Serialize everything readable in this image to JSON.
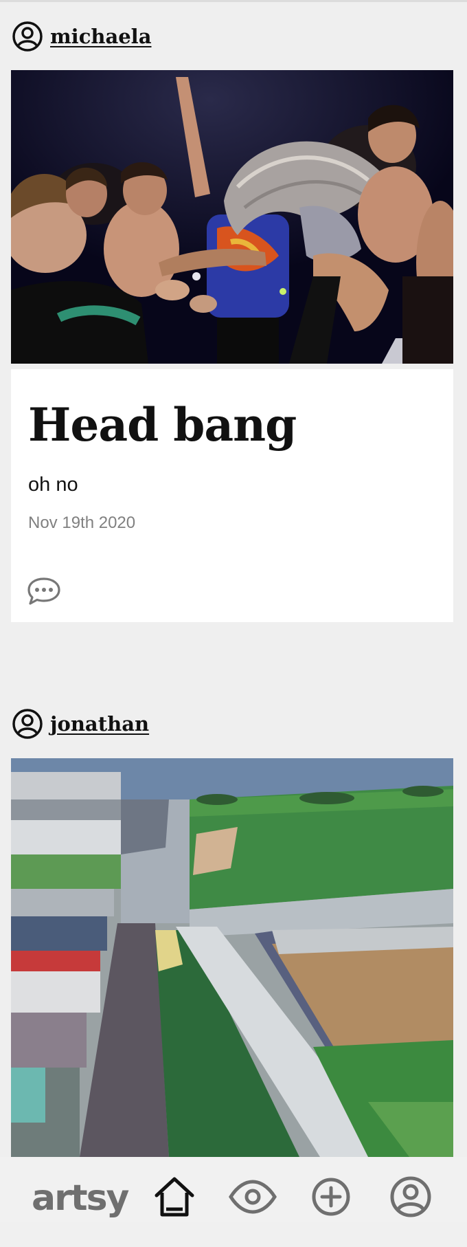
{
  "posts": [
    {
      "username": "michaela",
      "photo_alt": "photo-crowd",
      "title": "Head bang",
      "caption": "oh no",
      "date": "Nov 19th 2020",
      "comment_icon": "speech-bubble-icon"
    },
    {
      "username": "jonathan",
      "photo_alt": "photo-landscape-painting"
    }
  ],
  "tabbar": {
    "logo": "artsy",
    "tabs": [
      {
        "name": "home",
        "icon": "home-icon",
        "active": true
      },
      {
        "name": "discover",
        "icon": "eye-icon",
        "active": false
      },
      {
        "name": "create",
        "icon": "plus-circle-icon",
        "active": false
      },
      {
        "name": "profile",
        "icon": "user-circle-icon",
        "active": false
      }
    ]
  },
  "colors": {
    "background": "#efefef",
    "card": "#ffffff",
    "text": "#111111",
    "muted": "#808080",
    "tab_inactive": "#6f6f6f"
  }
}
